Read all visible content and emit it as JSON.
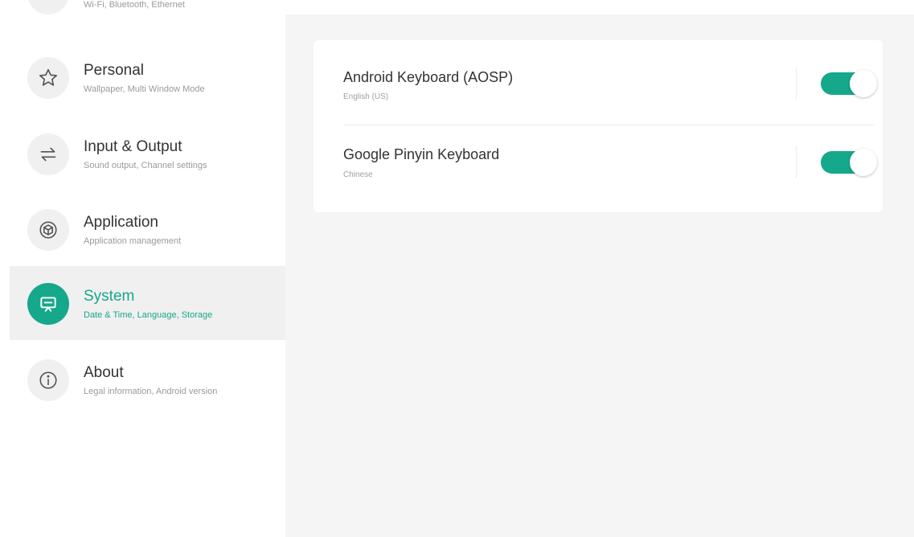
{
  "sidebar": {
    "cut_item": {
      "subtitle": "Wi-Fi, Bluetooth, Ethernet",
      "icon": "network-icon"
    },
    "items": [
      {
        "title": "Personal",
        "subtitle": "Wallpaper, Multi Window Mode",
        "icon": "star-icon"
      },
      {
        "title": "Input & Output",
        "subtitle": "Sound output, Channel settings",
        "icon": "swap-arrows-icon"
      },
      {
        "title": "Application",
        "subtitle": "Application management",
        "icon": "hexagon-app-icon"
      },
      {
        "title": "System",
        "subtitle": "Date & Time, Language, Storage",
        "icon": "presentation-icon"
      },
      {
        "title": "About",
        "subtitle": "Legal information, Android version",
        "icon": "info-icon"
      }
    ],
    "active_index": 3
  },
  "keyboards": [
    {
      "title": "Android Keyboard (AOSP)",
      "subtitle": "English (US)",
      "enabled": true
    },
    {
      "title": "Google Pinyin Keyboard",
      "subtitle": "Chinese",
      "enabled": true
    }
  ],
  "colors": {
    "accent": "#15a88a",
    "inactive_icon": "#555555",
    "panel_background": "#f5f5f5",
    "active_item_background": "#f0f0f0"
  }
}
